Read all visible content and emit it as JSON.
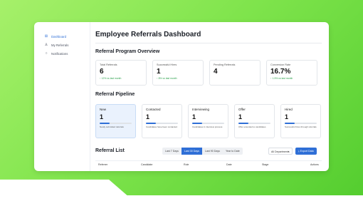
{
  "sidebar": {
    "items": [
      {
        "icon": "grid-icon",
        "glyph": "⊞",
        "label": "Dashboard",
        "active": true
      },
      {
        "icon": "user-icon",
        "glyph": "♙",
        "label": "My Referrals",
        "active": false
      },
      {
        "icon": "bell-icon",
        "glyph": "○",
        "label": "Notifications",
        "active": false
      }
    ]
  },
  "header": {
    "title": "Employee Referrals Dashboard"
  },
  "overview": {
    "title": "Referral Program Overview",
    "stats": [
      {
        "label": "Total Referrals",
        "value": "6",
        "trend": "↑ 12% vs last month"
      },
      {
        "label": "Successful Hires",
        "value": "1",
        "trend": "↑ 8% vs last month"
      },
      {
        "label": "Pending Referrals",
        "value": "4",
        "trend": ""
      },
      {
        "label": "Conversion Rate",
        "value": "16.7%",
        "trend": "↑ 1.5% vs last month"
      }
    ]
  },
  "pipeline": {
    "title": "Referral Pipeline",
    "stages": [
      {
        "label": "New",
        "value": "1",
        "progress": 0.3,
        "desc": "Newly submitted referrals"
      },
      {
        "label": "Contacted",
        "value": "1",
        "progress": 0.3,
        "desc": "Candidates have been contacted"
      },
      {
        "label": "Interviewing",
        "value": "1",
        "progress": 0.3,
        "desc": "Candidates in interview process"
      },
      {
        "label": "Offer",
        "value": "1",
        "progress": 0.3,
        "desc": "Offer extended to candidates"
      },
      {
        "label": "Hired",
        "value": "1",
        "progress": 0.3,
        "desc": "Successful hires through referrals"
      }
    ]
  },
  "list": {
    "title": "Referral List",
    "filters": [
      "Last 7 Days",
      "Last 30 Days",
      "Last 90 Days",
      "Year to Date"
    ],
    "active_filter": "Last 30 Days",
    "department": "All Departments",
    "export_label": "Export Data",
    "columns": [
      "Referrer",
      "Candidate",
      "Role",
      "Date",
      "Stage",
      "Actions"
    ]
  },
  "colors": {
    "accent": "#2f6fd6",
    "success": "#2aa04a",
    "background": "#7fe44c"
  }
}
